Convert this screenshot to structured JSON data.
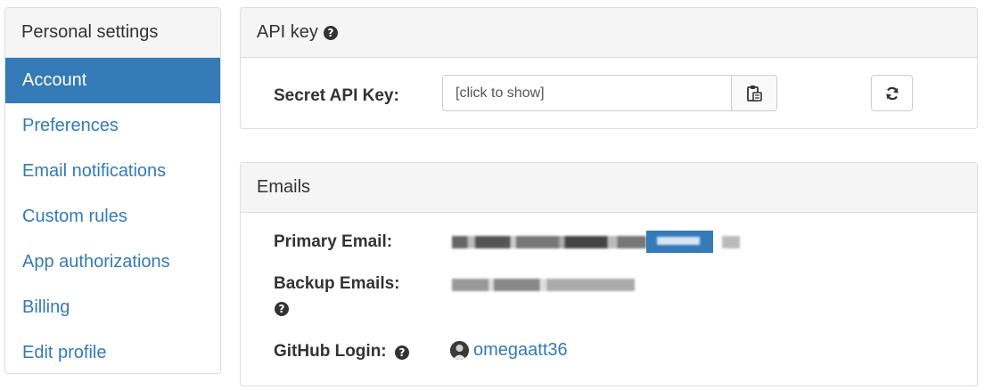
{
  "sidebar": {
    "heading": "Personal settings",
    "items": [
      {
        "label": "Account"
      },
      {
        "label": "Preferences"
      },
      {
        "label": "Email notifications"
      },
      {
        "label": "Custom rules"
      },
      {
        "label": "App authorizations"
      },
      {
        "label": "Billing"
      },
      {
        "label": "Edit profile"
      }
    ],
    "active_item": "Account"
  },
  "api_panel": {
    "title": "API key",
    "secret_label": "Secret API Key:",
    "key_placeholder": "[click to show]",
    "clipboard_icon": "clipboard-icon",
    "refresh_icon": "refresh-icon"
  },
  "email_panel": {
    "title": "Emails",
    "primary_label": "Primary Email:",
    "backup_label": "Backup Emails:",
    "github_label": "GitHub Login:",
    "github_username": "omegaatt36"
  },
  "colors": {
    "accent": "#337ab7",
    "panel_heading_bg": "#f5f5f5",
    "border": "#dddddd"
  }
}
